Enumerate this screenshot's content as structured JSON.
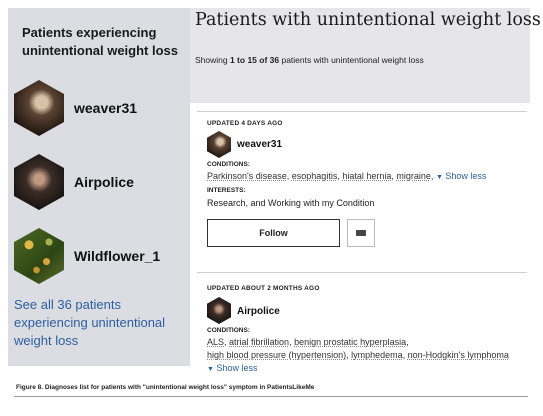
{
  "sidebar": {
    "title": "Patients experiencing unintentional weight loss",
    "patients": [
      {
        "name": "weaver31"
      },
      {
        "name": "Airpolice"
      },
      {
        "name": "Wildflower_1"
      }
    ],
    "see_all": "See all 36 patients experiencing unintentional weight loss"
  },
  "header": {
    "title": "Patients with unintentional weight loss",
    "showing_prefix": "Showing ",
    "showing_range": "1 to 15 of 36",
    "showing_suffix": " patients with unintentional weight loss"
  },
  "cards": [
    {
      "updated": "UPDATED 4 DAYS AGO",
      "user": "weaver31",
      "conditions_label": "CONDITIONS:",
      "conditions": [
        "Parkinson's disease",
        "esophagitis",
        "hiatal hernia",
        "migraine"
      ],
      "show_less": "Show less",
      "interests_label": "INTERESTS:",
      "interests": "Research, and Working with my Condition",
      "follow": "Follow"
    },
    {
      "updated": "UPDATED ABOUT 2 MONTHS AGO",
      "user": "Airpolice",
      "conditions_label": "CONDITIONS:",
      "conditions_line1": [
        "ALS",
        "atrial fibrillation",
        "benign prostatic hyperplasia"
      ],
      "conditions_line2": [
        "high blood pressure (hypertension)",
        "lymphedema",
        "non-Hodgkin's lymphoma"
      ],
      "show_less": "Show less"
    }
  ],
  "caption": "Figure 8. Diagnoses list for patients with \"unintentional weight loss\" symptom in PatientsLikeMe",
  "icons": {
    "expand": "triangle-down-icon",
    "message": "envelope-icon"
  }
}
